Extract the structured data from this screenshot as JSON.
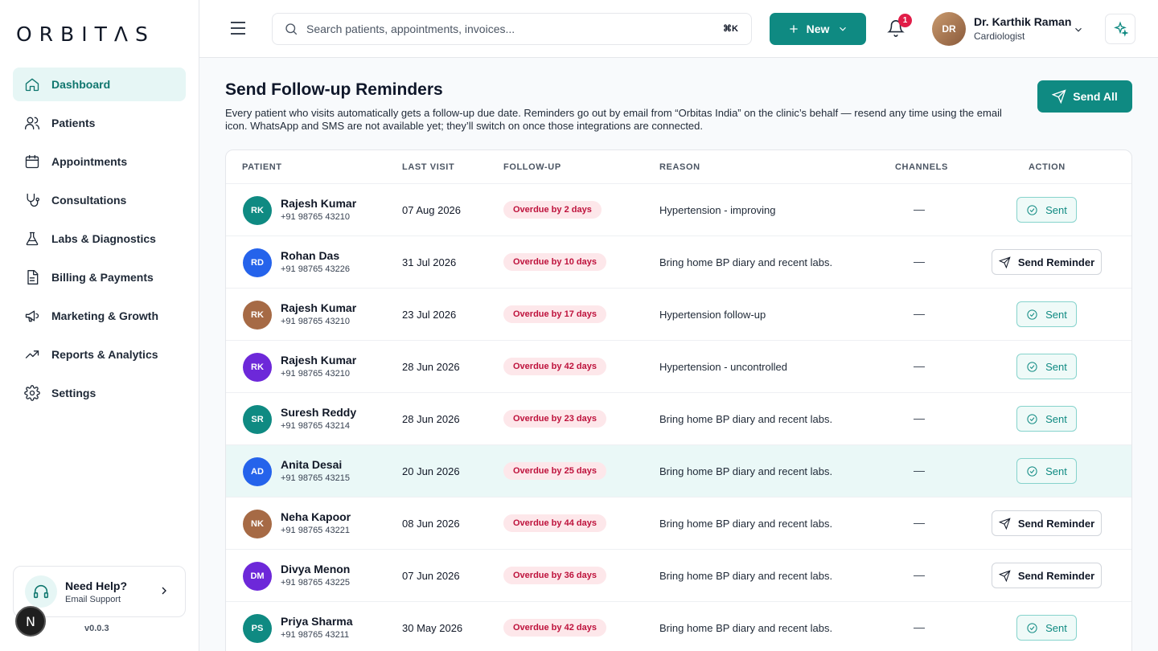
{
  "brand": {
    "logo": "ORBITΛS"
  },
  "sidebar": {
    "items": [
      {
        "label": "Dashboard",
        "icon": "home-icon",
        "active": true
      },
      {
        "label": "Patients",
        "icon": "users-icon"
      },
      {
        "label": "Appointments",
        "icon": "calendar-icon"
      },
      {
        "label": "Consultations",
        "icon": "stethoscope-icon"
      },
      {
        "label": "Labs & Diagnostics",
        "icon": "flask-icon"
      },
      {
        "label": "Billing & Payments",
        "icon": "invoice-icon"
      },
      {
        "label": "Marketing & Growth",
        "icon": "megaphone-icon"
      },
      {
        "label": "Reports & Analytics",
        "icon": "trend-icon"
      },
      {
        "label": "Settings",
        "icon": "gear-icon"
      }
    ],
    "help": {
      "title": "Need Help?",
      "subtitle": "Email Support"
    },
    "version": "v0.0.3",
    "dev_badge": "N"
  },
  "topbar": {
    "search_placeholder": "Search patients, appointments, invoices...",
    "search_shortcut": "⌘K",
    "new_label": "New",
    "notification_count": "1",
    "user": {
      "initials": "DR",
      "name": "Dr. Karthik Raman",
      "role": "Cardiologist"
    }
  },
  "page": {
    "title": "Send Follow-up Reminders",
    "description": "Every patient who visits automatically gets a follow-up due date. Reminders go out by email from “Orbitas India” on the clinic’s behalf — resend any time using the email icon. WhatsApp and SMS are not available yet; they’ll switch on once those integrations are connected.",
    "send_all_label": "Send All"
  },
  "table": {
    "headers": {
      "patient": "PATIENT",
      "last_visit": "LAST VISIT",
      "follow_up": "FOLLOW-UP",
      "reason": "REASON",
      "channels": "CHANNELS",
      "action": "ACTION"
    },
    "rows": [
      {
        "initials": "RK",
        "name": "Rajesh Kumar",
        "phone": "+91 98765 43210",
        "last_visit": "07 Aug 2026",
        "follow_up": "Overdue by 2 days",
        "reason": "Hypertension - improving",
        "channels": "—",
        "action": "Sent",
        "avatar_color": "#0f8a82"
      },
      {
        "initials": "RD",
        "name": "Rohan Das",
        "phone": "+91 98765 43226",
        "last_visit": "31 Jul 2026",
        "follow_up": "Overdue by 10 days",
        "reason": "Bring home BP diary and recent labs.",
        "channels": "—",
        "action": "Send Reminder",
        "avatar_color": "#2563eb"
      },
      {
        "initials": "RK",
        "name": "Rajesh Kumar",
        "phone": "+91 98765 43210",
        "last_visit": "23 Jul 2026",
        "follow_up": "Overdue by 17 days",
        "reason": "Hypertension follow-up",
        "channels": "—",
        "action": "Sent",
        "avatar_color": "#a66a45"
      },
      {
        "initials": "RK",
        "name": "Rajesh Kumar",
        "phone": "+91 98765 43210",
        "last_visit": "28 Jun 2026",
        "follow_up": "Overdue by 42 days",
        "reason": "Hypertension - uncontrolled",
        "channels": "—",
        "action": "Sent",
        "avatar_color": "#6d28d9"
      },
      {
        "initials": "SR",
        "name": "Suresh Reddy",
        "phone": "+91 98765 43214",
        "last_visit": "28 Jun 2026",
        "follow_up": "Overdue by 23 days",
        "reason": "Bring home BP diary and recent labs.",
        "channels": "—",
        "action": "Sent",
        "avatar_color": "#0f8a82"
      },
      {
        "initials": "AD",
        "name": "Anita Desai",
        "phone": "+91 98765 43215",
        "last_visit": "20 Jun 2026",
        "follow_up": "Overdue by 25 days",
        "reason": "Bring home BP diary and recent labs.",
        "channels": "—",
        "action": "Sent",
        "avatar_color": "#2563eb",
        "highlight": true
      },
      {
        "initials": "NK",
        "name": "Neha Kapoor",
        "phone": "+91 98765 43221",
        "last_visit": "08 Jun 2026",
        "follow_up": "Overdue by 44 days",
        "reason": "Bring home BP diary and recent labs.",
        "channels": "—",
        "action": "Send Reminder",
        "avatar_color": "#a66a45"
      },
      {
        "initials": "DM",
        "name": "Divya Menon",
        "phone": "+91 98765 43225",
        "last_visit": "07 Jun 2026",
        "follow_up": "Overdue by 36 days",
        "reason": "Bring home BP diary and recent labs.",
        "channels": "—",
        "action": "Send Reminder",
        "avatar_color": "#6d28d9"
      },
      {
        "initials": "PS",
        "name": "Priya Sharma",
        "phone": "+91 98765 43211",
        "last_visit": "30 May 2026",
        "follow_up": "Overdue by 42 days",
        "reason": "Bring home BP diary and recent labs.",
        "channels": "—",
        "action": "Sent",
        "avatar_color": "#0f8a82"
      }
    ]
  },
  "colors": {
    "accent": "#0f8a82",
    "overdue_bg": "#fde7ea",
    "overdue_text": "#be123c",
    "row_highlight": "#eaf8f7"
  }
}
